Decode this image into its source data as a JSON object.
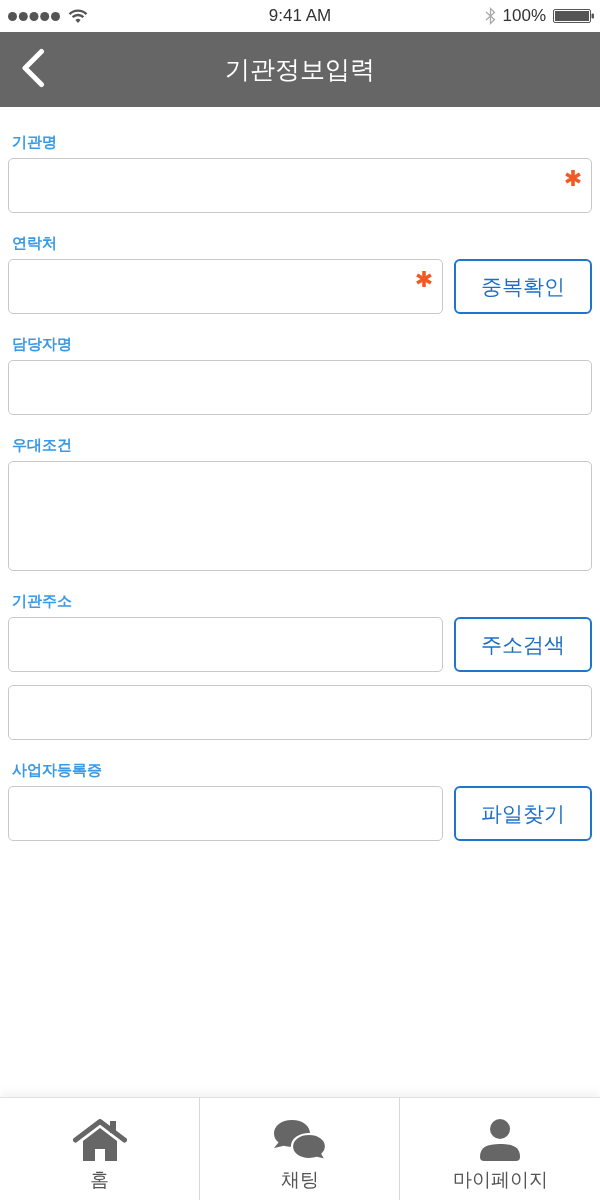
{
  "status_bar": {
    "time": "9:41 AM",
    "battery": "100%"
  },
  "header": {
    "title": "기관정보입력"
  },
  "form": {
    "sections": [
      {
        "label": "기관명",
        "inputs": [
          {
            "kind": "text",
            "required": true
          }
        ]
      },
      {
        "label": "연락처",
        "inputs": [
          {
            "kind": "text",
            "required": true,
            "button": "중복확인"
          }
        ]
      },
      {
        "label": "담당자명",
        "inputs": [
          {
            "kind": "text",
            "required": false
          }
        ]
      },
      {
        "label": "우대조건",
        "inputs": [
          {
            "kind": "textarea",
            "required": false
          }
        ]
      },
      {
        "label": "기관주소",
        "inputs": [
          {
            "kind": "text",
            "required": false,
            "button": "주소검색"
          },
          {
            "kind": "text",
            "required": false
          }
        ]
      },
      {
        "label": "사업자등록증",
        "inputs": [
          {
            "kind": "text",
            "required": false,
            "button": "파일찾기"
          }
        ]
      }
    ]
  },
  "tab_bar": {
    "items": [
      {
        "label": "홈"
      },
      {
        "label": "채팅"
      },
      {
        "label": "마이페이지"
      }
    ]
  }
}
